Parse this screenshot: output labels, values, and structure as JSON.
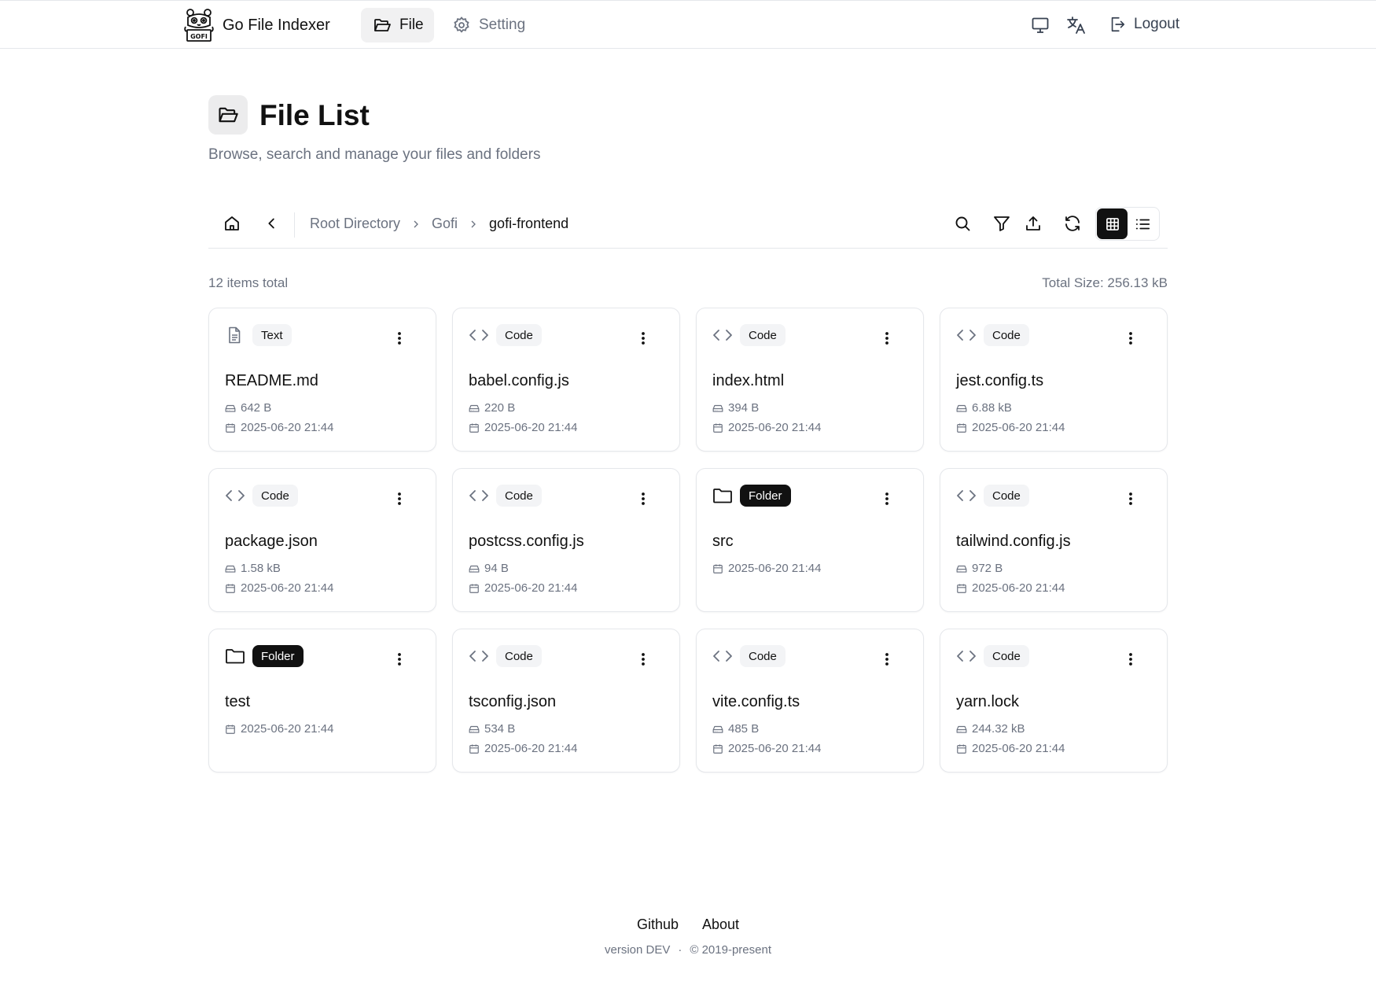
{
  "header": {
    "brand": {
      "name": "Go File Indexer",
      "logo_text": "GOFI"
    },
    "nav": [
      {
        "label": "File",
        "active": true,
        "icon": "folder-open-icon"
      },
      {
        "label": "Setting",
        "active": false,
        "icon": "gear-icon"
      }
    ],
    "right": {
      "monitor_icon": "monitor-icon",
      "translate_icon": "translate-icon",
      "logout_label": "Logout"
    }
  },
  "page": {
    "title": "File List",
    "subtitle": "Browse, search and manage your files and folders"
  },
  "breadcrumb": [
    "Root Directory",
    "Gofi",
    "gofi-frontend"
  ],
  "toolbar": {
    "icons": [
      "home-icon",
      "back-icon",
      "search-icon",
      "filter-icon",
      "upload-icon",
      "refresh-icon",
      "grid-view-icon",
      "list-view-icon"
    ],
    "active_view": "grid"
  },
  "summary": {
    "count": "12 items total",
    "total_size": "Total Size: 256.13 kB"
  },
  "files": [
    {
      "name": "README.md",
      "type": "Text",
      "kind": "text",
      "size": "642 B",
      "date": "2025-06-20 21:44"
    },
    {
      "name": "babel.config.js",
      "type": "Code",
      "kind": "code",
      "size": "220 B",
      "date": "2025-06-20 21:44"
    },
    {
      "name": "index.html",
      "type": "Code",
      "kind": "code",
      "size": "394 B",
      "date": "2025-06-20 21:44"
    },
    {
      "name": "jest.config.ts",
      "type": "Code",
      "kind": "code",
      "size": "6.88 kB",
      "date": "2025-06-20 21:44"
    },
    {
      "name": "package.json",
      "type": "Code",
      "kind": "code",
      "size": "1.58 kB",
      "date": "2025-06-20 21:44"
    },
    {
      "name": "postcss.config.js",
      "type": "Code",
      "kind": "code",
      "size": "94 B",
      "date": "2025-06-20 21:44"
    },
    {
      "name": "src",
      "type": "Folder",
      "kind": "folder",
      "size": null,
      "date": "2025-06-20 21:44"
    },
    {
      "name": "tailwind.config.js",
      "type": "Code",
      "kind": "code",
      "size": "972 B",
      "date": "2025-06-20 21:44"
    },
    {
      "name": "test",
      "type": "Folder",
      "kind": "folder",
      "size": null,
      "date": "2025-06-20 21:44"
    },
    {
      "name": "tsconfig.json",
      "type": "Code",
      "kind": "code",
      "size": "534 B",
      "date": "2025-06-20 21:44"
    },
    {
      "name": "vite.config.ts",
      "type": "Code",
      "kind": "code",
      "size": "485 B",
      "date": "2025-06-20 21:44"
    },
    {
      "name": "yarn.lock",
      "type": "Code",
      "kind": "code",
      "size": "244.32 kB",
      "date": "2025-06-20 21:44"
    }
  ],
  "footer": {
    "links": [
      "Github",
      "About"
    ],
    "version": "version DEV",
    "separator": "·",
    "copyright": "© 2019-present"
  },
  "colors": {
    "text": "#111111",
    "muted": "#6b7280",
    "border": "#e5e7eb",
    "active_bg": "#111111",
    "badge_bg": "#f3f4f6"
  }
}
